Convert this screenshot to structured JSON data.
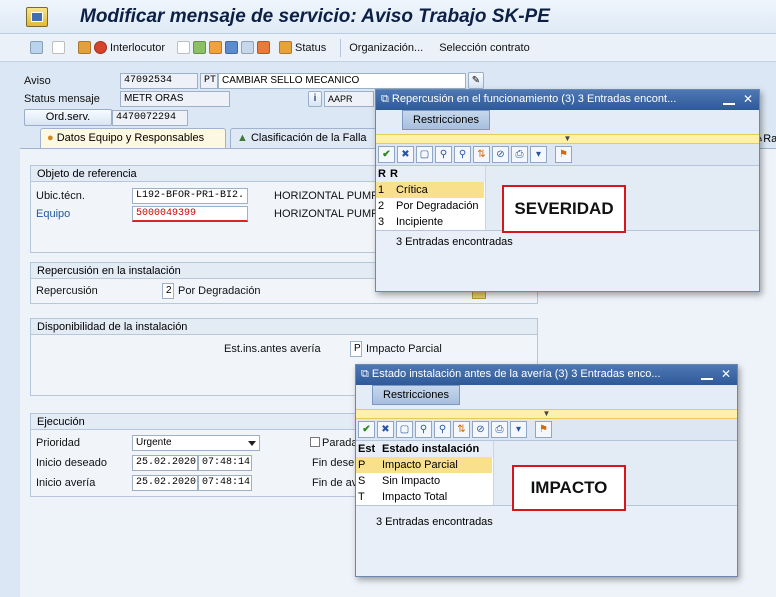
{
  "window": {
    "title": "Modificar mensaje de servicio: Aviso Trabajo SK-PE"
  },
  "toolbar": {
    "interlocutor": "Interlocutor",
    "status": "Status",
    "organizacion": "Organización...",
    "seleccion": "Selección contrato"
  },
  "header": {
    "aviso_label": "Aviso",
    "aviso_num": "47092534",
    "aviso_type": "PT",
    "aviso_desc": "CAMBIAR SELLO MECANICO",
    "status_label": "Status mensaje",
    "status_value": "METR ORAS",
    "status_code": "AAPR",
    "ordserv_label": "Ord.serv.",
    "ordserv_value": "4470072294"
  },
  "tabs": [
    "Datos Equipo y Responsables",
    "Clasificación de la Falla"
  ],
  "tab_right_fragment": "Ra",
  "objeto": {
    "title": "Objeto de referencia",
    "ubic_label": "Ubic.técn.",
    "ubic_value": "L192-BFOR-PR1-BI2.",
    "ubic_desc": "HORIZONTAL PUMPI",
    "equipo_label": "Equipo",
    "equipo_value": "5000049399",
    "equipo_desc": "HORIZONTAL PUMPI"
  },
  "repercusion": {
    "title": "Repercusión en la instalación",
    "label": "Repercusión",
    "code": "2",
    "value": "Por Degradación"
  },
  "disponibilidad": {
    "title": "Disponibilidad de la instalación",
    "label": "Est.ins.antes avería",
    "code": "P",
    "value": "Impacto Parcial"
  },
  "ejecucion": {
    "title": "Ejecución",
    "prioridad_label": "Prioridad",
    "prioridad_value": "Urgente",
    "inicio_label": "Inicio deseado",
    "inicio_date": "25.02.2020",
    "inicio_time": "07:48:14",
    "averia_label": "Inicio avería",
    "averia_date": "25.02.2020",
    "averia_time": "07:48:14",
    "parada_label": "Parada",
    "fin_deseado_label": "Fin dese",
    "fin_averia_label": "Fin de av"
  },
  "popup1": {
    "title": "Repercusión en el funcionamiento (3)   3 Entradas encont...",
    "tab": "Restricciones",
    "col1": "R",
    "col2": "R",
    "rows": [
      {
        "code": "1",
        "text": "Crítica"
      },
      {
        "code": "2",
        "text": "Por Degradación"
      },
      {
        "code": "3",
        "text": "Incipiente"
      }
    ],
    "status": "3 Entradas encontradas",
    "annotation": "SEVERIDAD"
  },
  "popup2": {
    "title": "Estado instalación antes de la avería (3)   3 Entradas enco...",
    "tab": "Restricciones",
    "col1": "Est",
    "col2": "Estado instalación",
    "rows": [
      {
        "code": "P",
        "text": "Impacto Parcial"
      },
      {
        "code": "S",
        "text": "Sin Impacto"
      },
      {
        "code": "T",
        "text": "Impacto Total"
      }
    ],
    "status": "3 Entradas encontradas",
    "annotation": "IMPACTO"
  }
}
